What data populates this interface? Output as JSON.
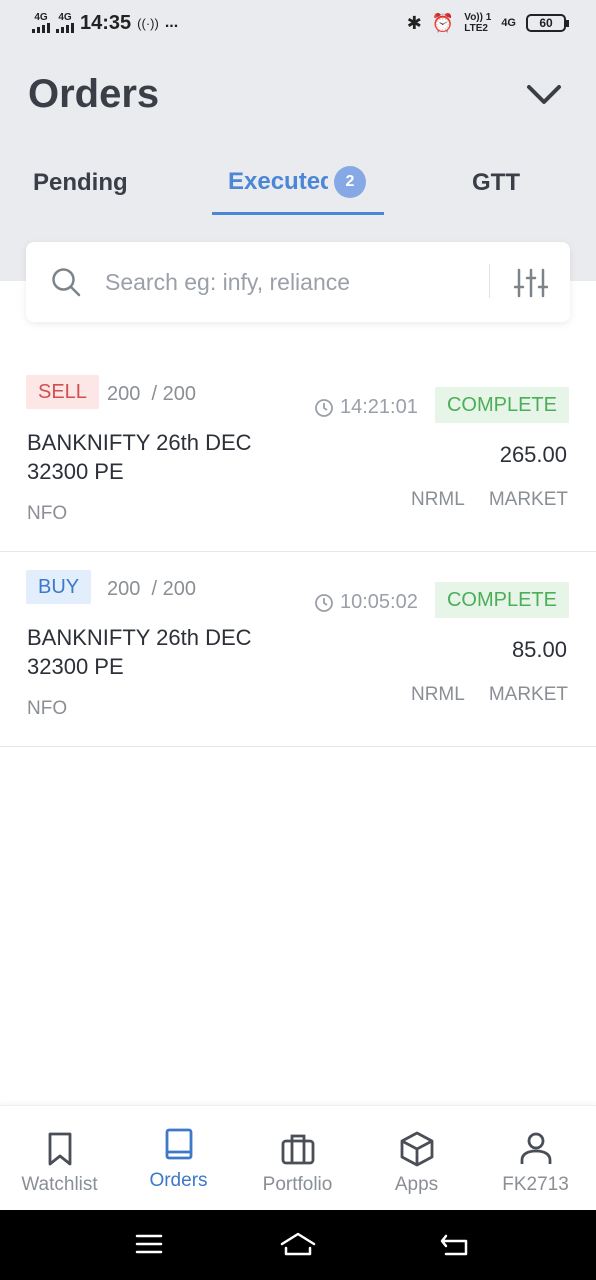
{
  "status_bar": {
    "network1": "4G",
    "network2": "4G",
    "time": "14:35",
    "extra": "...",
    "volte": "Vo)) 1",
    "lte": "LTE2",
    "network3": "4G",
    "battery": "60"
  },
  "header": {
    "title": "Orders",
    "expand_icon": "chevron-down-icon"
  },
  "tabs": [
    {
      "label": "Pending",
      "active": false
    },
    {
      "label": "Executed",
      "badge": "2",
      "active": true
    },
    {
      "label": "GTT",
      "active": false
    }
  ],
  "search": {
    "placeholder": "Search eg: infy, reliance",
    "icon": "search-icon",
    "filter_icon": "sliders-icon"
  },
  "orders": [
    {
      "side": "SELL",
      "qty": "200",
      "qty_sep": "/ 200",
      "time": "14:21:01",
      "status": "COMPLETE",
      "symbol_line1": "BANKNIFTY 26th DEC",
      "symbol_line2": "32300 PE",
      "price": "265.00",
      "exchange": "NFO",
      "product": "NRML",
      "order_type": "MARKET"
    },
    {
      "side": "BUY",
      "qty": "200",
      "qty_sep": "/ 200",
      "time": "10:05:02",
      "status": "COMPLETE",
      "symbol_line1": "BANKNIFTY 26th DEC",
      "symbol_line2": "32300 PE",
      "price": "85.00",
      "exchange": "NFO",
      "product": "NRML",
      "order_type": "MARKET"
    }
  ],
  "bottom_nav": [
    {
      "label": "Watchlist",
      "icon": "bookmark-icon",
      "active": false
    },
    {
      "label": "Orders",
      "icon": "book-icon",
      "active": true
    },
    {
      "label": "Portfolio",
      "icon": "briefcase-icon",
      "active": false
    },
    {
      "label": "Apps",
      "icon": "cube-icon",
      "active": false
    },
    {
      "label": "FK2713",
      "icon": "user-icon",
      "active": false
    }
  ],
  "colors": {
    "accent": "#4b87d6",
    "sell": "#d34f4f",
    "buy": "#3d78c9",
    "complete": "#4cae57",
    "header_bg": "#e9ebee"
  }
}
